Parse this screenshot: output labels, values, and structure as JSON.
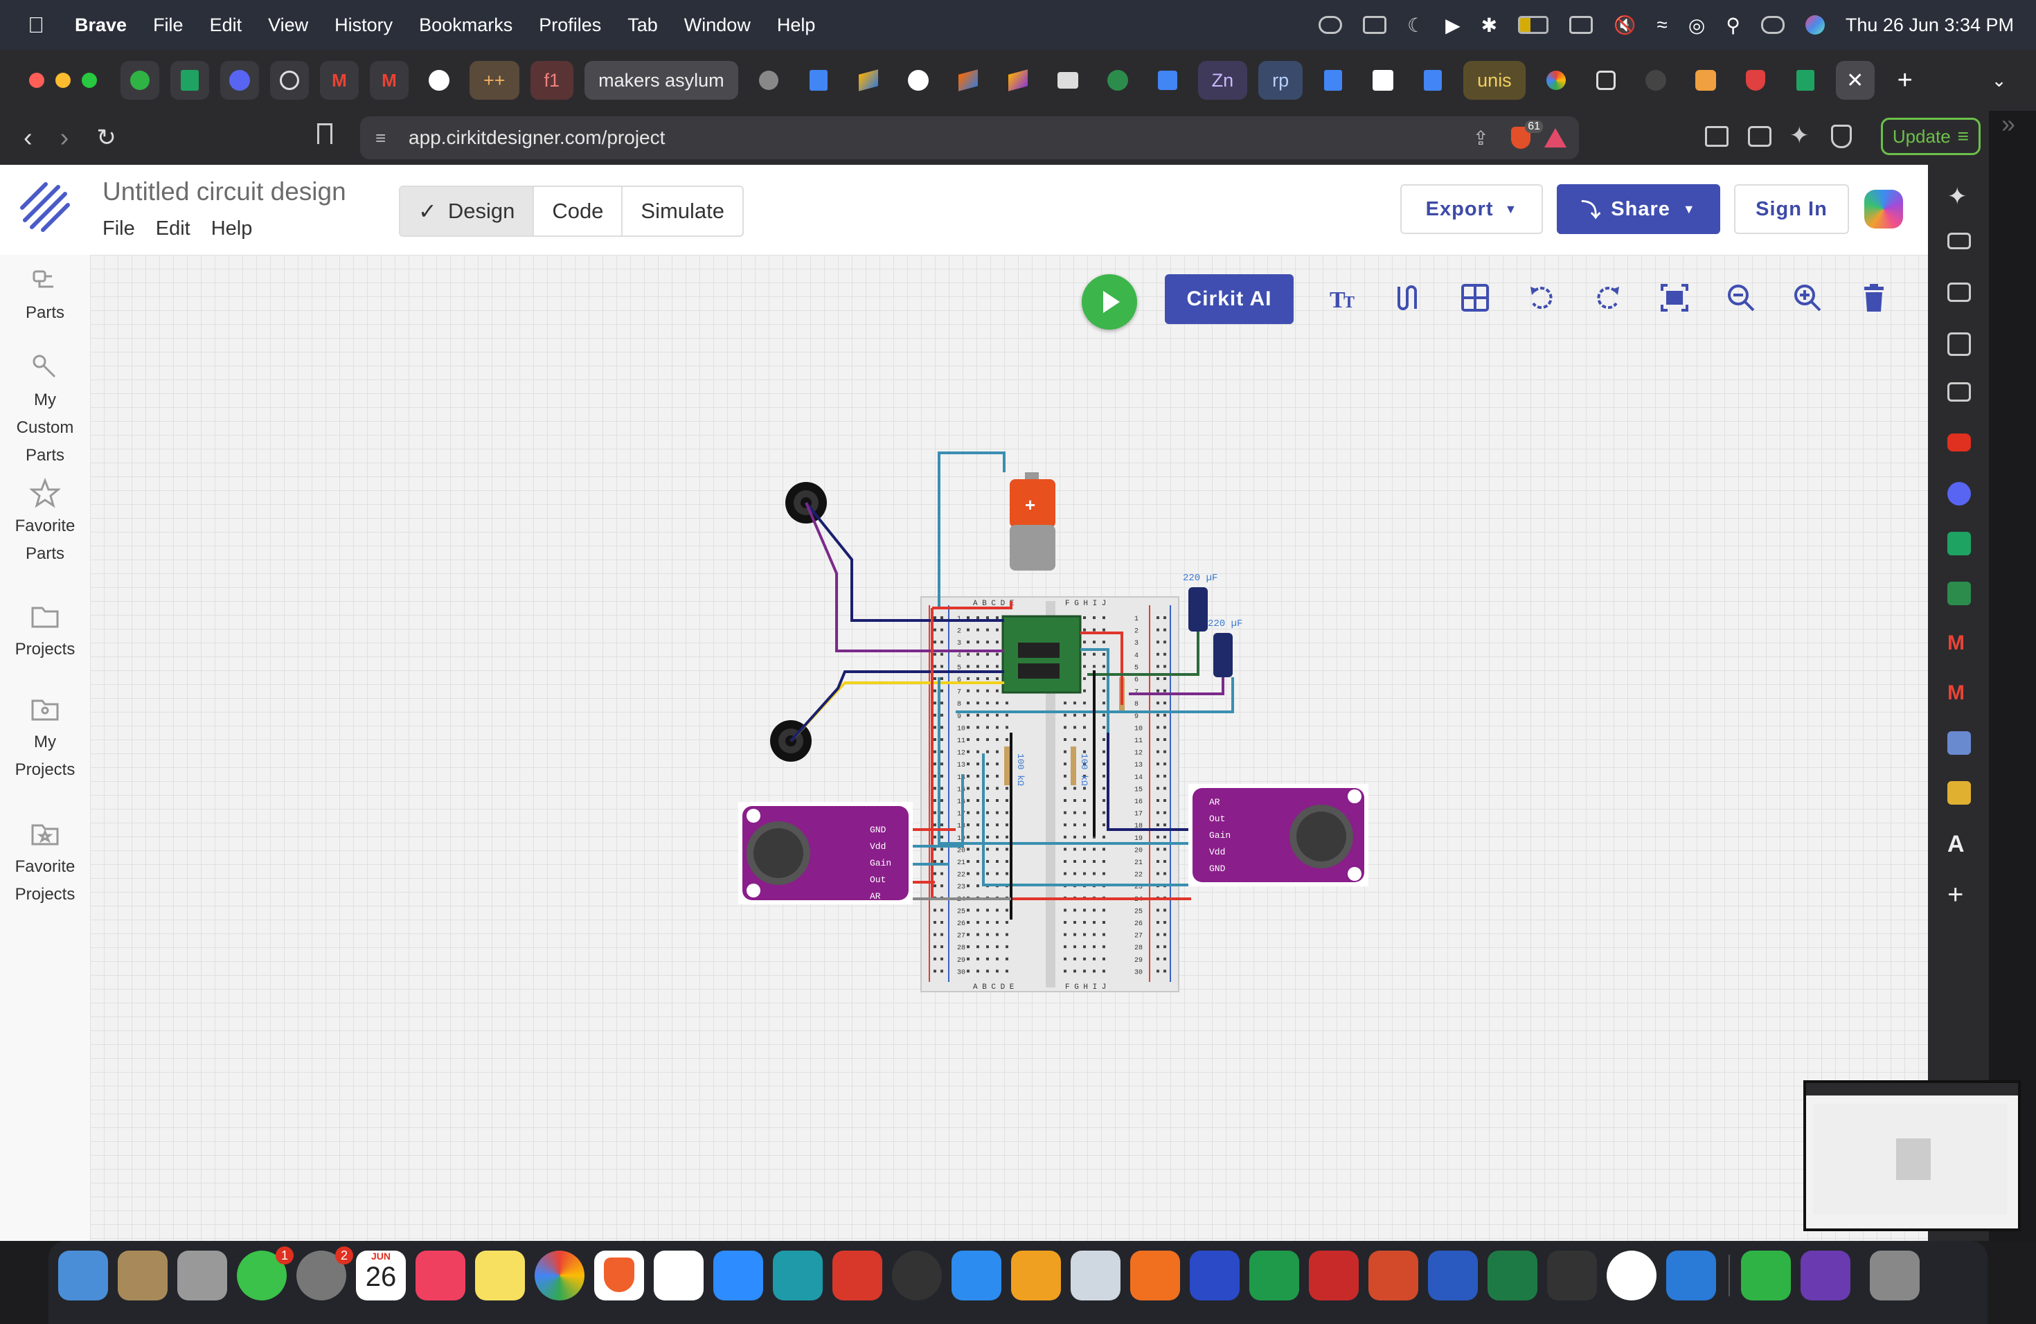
{
  "menubar": {
    "app": "Brave",
    "items": [
      "File",
      "Edit",
      "View",
      "History",
      "Bookmarks",
      "Profiles",
      "Tab",
      "Window",
      "Help"
    ],
    "datetime": "Thu 26 Jun  3:34 PM"
  },
  "tabs": {
    "labels": [
      "++",
      "f1",
      "makers asylum",
      "Zn",
      "rp",
      "unis"
    ]
  },
  "browser": {
    "url": "app.cirkitdesigner.com/project",
    "badge": "61",
    "update_label": "Update"
  },
  "header": {
    "title": "Untitled circuit design",
    "menu": [
      "File",
      "Edit",
      "Help"
    ],
    "modes": [
      "Design",
      "Code",
      "Simulate"
    ],
    "active_mode": "Design",
    "export_label": "Export",
    "share_label": "Share",
    "signin_label": "Sign In"
  },
  "sidebar": {
    "items": [
      {
        "label": "Parts"
      },
      {
        "label": "My Custom Parts"
      },
      {
        "label": "Favorite Parts"
      },
      {
        "label": "Projects"
      },
      {
        "label": "My Projects"
      },
      {
        "label": "Favorite Projects"
      }
    ]
  },
  "toolbar": {
    "cirkit_ai_label": "Cirkit AI"
  },
  "circuit": {
    "cap_labels": [
      "220 µF",
      "220 µF"
    ],
    "res_labels": [
      "100 kΩ",
      "100 kΩ"
    ],
    "breadboard_cols_left": "A B C D E",
    "breadboard_cols_right": "F G H I J",
    "rows": [
      "1",
      "2",
      "3",
      "4",
      "5",
      "6",
      "7",
      "8",
      "9",
      "10",
      "11",
      "12",
      "13",
      "14",
      "15",
      "16",
      "17",
      "18",
      "19",
      "20",
      "21",
      "22",
      "23",
      "24",
      "25",
      "26",
      "27",
      "28",
      "29",
      "30"
    ],
    "mic_left_pins": [
      "GND",
      "Vdd",
      "Gain",
      "Out",
      "AR"
    ],
    "mic_right_pins": [
      "AR",
      "Out",
      "Gain",
      "Vdd",
      "GND"
    ]
  },
  "dock": {
    "calendar_month": "JUN",
    "calendar_day": "26",
    "badges": [
      "1",
      "2"
    ]
  },
  "colors": {
    "accent": "#3f4eb0",
    "play": "#3cb54a",
    "mic_board": "#8a1e8a",
    "wire_red": "#e0352b",
    "wire_blue": "#3a8fb0",
    "wire_navy": "#1a1f6e",
    "wire_purple": "#7a2a8a",
    "wire_green": "#2d6a3a",
    "wire_yellow": "#f2d21a"
  }
}
